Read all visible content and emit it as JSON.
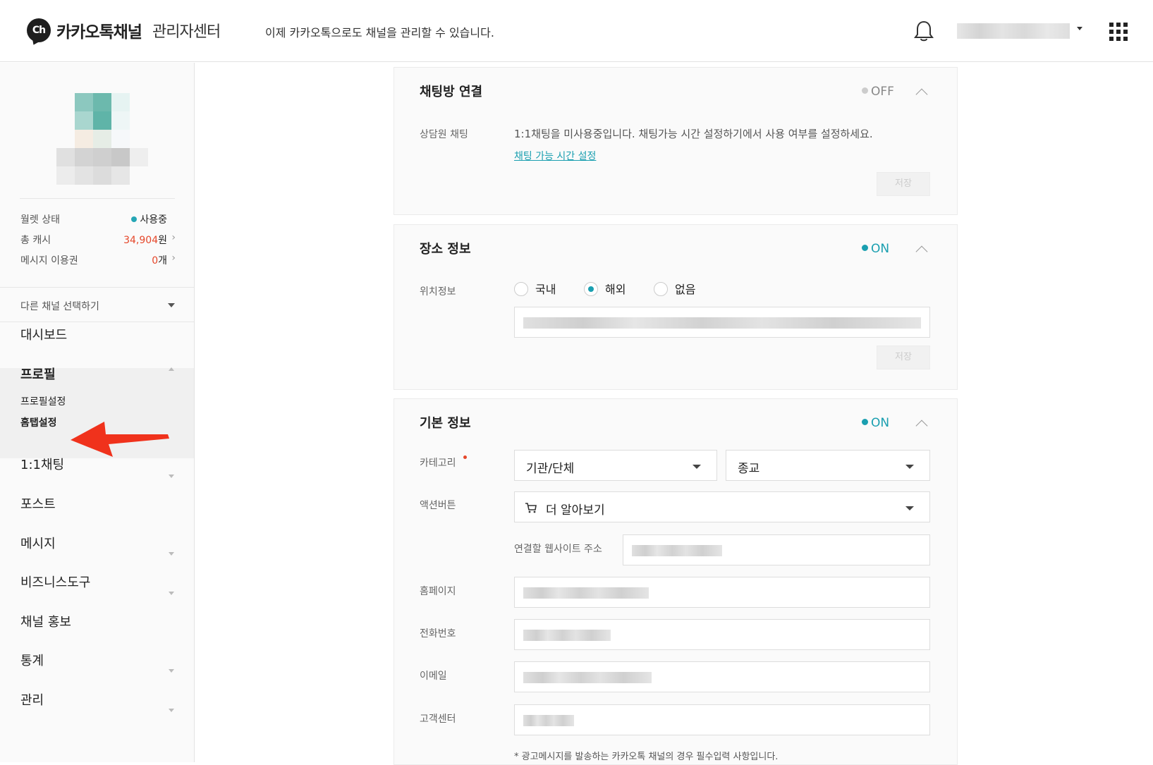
{
  "header": {
    "logo_badge": "Ch",
    "brand": "카카오톡채널",
    "brand_sub": "관리자센터",
    "notice": "이제 카카오톡으로도 채널을 관리할 수 있습니다."
  },
  "sidebar": {
    "wallet": [
      {
        "label": "월렛 상태",
        "value": "사용중",
        "status": "active"
      },
      {
        "label": "총 캐시",
        "value": "34,904",
        "unit": "원"
      },
      {
        "label": "메시지 이용권",
        "value": "0",
        "unit": "개"
      }
    ],
    "channel_select": "다른 채널 선택하기",
    "nav": {
      "dashboard": "대시보드",
      "profile": "프로필",
      "profile_settings": "프로필설정",
      "home_tab_settings": "홈탭설정",
      "chat": "1:1채팅",
      "post": "포스트",
      "message": "메시지",
      "business_tools": "비즈니스도구",
      "promotion": "채널 홍보",
      "stats": "통계",
      "manage": "관리"
    }
  },
  "cards": {
    "chat_connect": {
      "title": "채팅방 연결",
      "toggle": "OFF",
      "field_label": "상담원 채팅",
      "description": "1:1채팅을 미사용중입니다. 채팅가능 시간 설정하기에서 사용 여부를 설정하세요.",
      "link": "채팅 가능 시간 설정",
      "save": "저장"
    },
    "place_info": {
      "title": "장소 정보",
      "toggle": "ON",
      "field_label": "위치정보",
      "options": [
        "국내",
        "해외",
        "없음"
      ],
      "selected": "해외",
      "save": "저장"
    },
    "basic_info": {
      "title": "기본 정보",
      "toggle": "ON",
      "category_label": "카테고리",
      "category_1": "기관/단체",
      "category_2": "종교",
      "action_label": "액션버튼",
      "action_value": "더 알아보기",
      "website_label": "연결할 웹사이트 주소",
      "homepage_label": "홈페이지",
      "phone_label": "전화번호",
      "email_label": "이메일",
      "cs_label": "고객센터",
      "footnote": "* 광고메시지를 발송하는 카카오톡 채널의 경우 필수입력 사항입니다."
    }
  },
  "colors": {
    "accent": "#1a9fb0",
    "alert": "#e5472a"
  }
}
